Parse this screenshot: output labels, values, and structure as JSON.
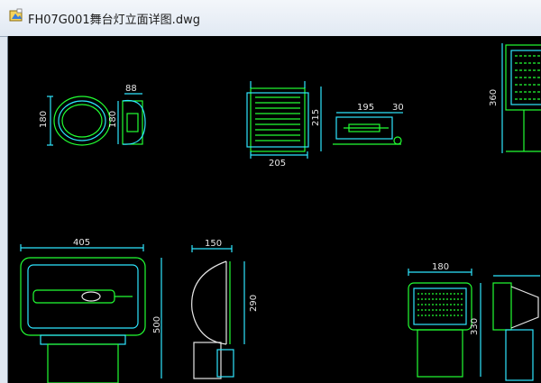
{
  "window": {
    "title": "FH07G001舞台灯立面详图.dwg",
    "icon": "dwg-file-icon"
  },
  "drawing": {
    "background": "#000000",
    "line_colors": {
      "green": "#22ff33",
      "cyan": "#2ee6ff",
      "white": "#e6e6e6"
    },
    "dims": {
      "lamp1_height": "180",
      "lamp1_side_height": "180",
      "lamp1_depth": "88",
      "lamp2_height": "215",
      "lamp2_width": "205",
      "lamp3_width": "195",
      "lamp3_offset": "30",
      "lamp4_height": "360",
      "lamp5_width": "405",
      "lamp5_height": "500",
      "lamp6_depth": "150",
      "lamp6_height": "290",
      "lamp7_width": "180",
      "lamp7_height": "330"
    }
  }
}
